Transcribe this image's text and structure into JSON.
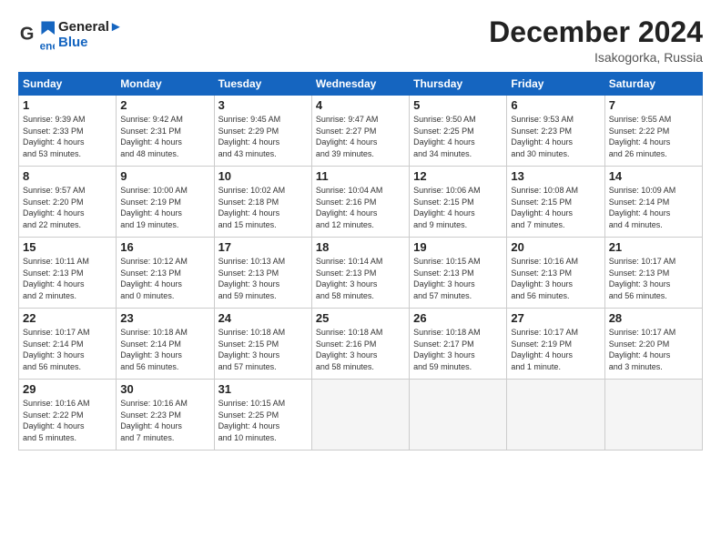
{
  "header": {
    "logo_general": "General",
    "logo_blue": "Blue",
    "month": "December 2024",
    "location": "Isakogorka, Russia"
  },
  "weekdays": [
    "Sunday",
    "Monday",
    "Tuesday",
    "Wednesday",
    "Thursday",
    "Friday",
    "Saturday"
  ],
  "weeks": [
    [
      {
        "day": "1",
        "info": "Sunrise: 9:39 AM\nSunset: 2:33 PM\nDaylight: 4 hours\nand 53 minutes."
      },
      {
        "day": "2",
        "info": "Sunrise: 9:42 AM\nSunset: 2:31 PM\nDaylight: 4 hours\nand 48 minutes."
      },
      {
        "day": "3",
        "info": "Sunrise: 9:45 AM\nSunset: 2:29 PM\nDaylight: 4 hours\nand 43 minutes."
      },
      {
        "day": "4",
        "info": "Sunrise: 9:47 AM\nSunset: 2:27 PM\nDaylight: 4 hours\nand 39 minutes."
      },
      {
        "day": "5",
        "info": "Sunrise: 9:50 AM\nSunset: 2:25 PM\nDaylight: 4 hours\nand 34 minutes."
      },
      {
        "day": "6",
        "info": "Sunrise: 9:53 AM\nSunset: 2:23 PM\nDaylight: 4 hours\nand 30 minutes."
      },
      {
        "day": "7",
        "info": "Sunrise: 9:55 AM\nSunset: 2:22 PM\nDaylight: 4 hours\nand 26 minutes."
      }
    ],
    [
      {
        "day": "8",
        "info": "Sunrise: 9:57 AM\nSunset: 2:20 PM\nDaylight: 4 hours\nand 22 minutes."
      },
      {
        "day": "9",
        "info": "Sunrise: 10:00 AM\nSunset: 2:19 PM\nDaylight: 4 hours\nand 19 minutes."
      },
      {
        "day": "10",
        "info": "Sunrise: 10:02 AM\nSunset: 2:18 PM\nDaylight: 4 hours\nand 15 minutes."
      },
      {
        "day": "11",
        "info": "Sunrise: 10:04 AM\nSunset: 2:16 PM\nDaylight: 4 hours\nand 12 minutes."
      },
      {
        "day": "12",
        "info": "Sunrise: 10:06 AM\nSunset: 2:15 PM\nDaylight: 4 hours\nand 9 minutes."
      },
      {
        "day": "13",
        "info": "Sunrise: 10:08 AM\nSunset: 2:15 PM\nDaylight: 4 hours\nand 7 minutes."
      },
      {
        "day": "14",
        "info": "Sunrise: 10:09 AM\nSunset: 2:14 PM\nDaylight: 4 hours\nand 4 minutes."
      }
    ],
    [
      {
        "day": "15",
        "info": "Sunrise: 10:11 AM\nSunset: 2:13 PM\nDaylight: 4 hours\nand 2 minutes."
      },
      {
        "day": "16",
        "info": "Sunrise: 10:12 AM\nSunset: 2:13 PM\nDaylight: 4 hours\nand 0 minutes."
      },
      {
        "day": "17",
        "info": "Sunrise: 10:13 AM\nSunset: 2:13 PM\nDaylight: 3 hours\nand 59 minutes."
      },
      {
        "day": "18",
        "info": "Sunrise: 10:14 AM\nSunset: 2:13 PM\nDaylight: 3 hours\nand 58 minutes."
      },
      {
        "day": "19",
        "info": "Sunrise: 10:15 AM\nSunset: 2:13 PM\nDaylight: 3 hours\nand 57 minutes."
      },
      {
        "day": "20",
        "info": "Sunrise: 10:16 AM\nSunset: 2:13 PM\nDaylight: 3 hours\nand 56 minutes."
      },
      {
        "day": "21",
        "info": "Sunrise: 10:17 AM\nSunset: 2:13 PM\nDaylight: 3 hours\nand 56 minutes."
      }
    ],
    [
      {
        "day": "22",
        "info": "Sunrise: 10:17 AM\nSunset: 2:14 PM\nDaylight: 3 hours\nand 56 minutes."
      },
      {
        "day": "23",
        "info": "Sunrise: 10:18 AM\nSunset: 2:14 PM\nDaylight: 3 hours\nand 56 minutes."
      },
      {
        "day": "24",
        "info": "Sunrise: 10:18 AM\nSunset: 2:15 PM\nDaylight: 3 hours\nand 57 minutes."
      },
      {
        "day": "25",
        "info": "Sunrise: 10:18 AM\nSunset: 2:16 PM\nDaylight: 3 hours\nand 58 minutes."
      },
      {
        "day": "26",
        "info": "Sunrise: 10:18 AM\nSunset: 2:17 PM\nDaylight: 3 hours\nand 59 minutes."
      },
      {
        "day": "27",
        "info": "Sunrise: 10:17 AM\nSunset: 2:19 PM\nDaylight: 4 hours\nand 1 minute."
      },
      {
        "day": "28",
        "info": "Sunrise: 10:17 AM\nSunset: 2:20 PM\nDaylight: 4 hours\nand 3 minutes."
      }
    ],
    [
      {
        "day": "29",
        "info": "Sunrise: 10:16 AM\nSunset: 2:22 PM\nDaylight: 4 hours\nand 5 minutes."
      },
      {
        "day": "30",
        "info": "Sunrise: 10:16 AM\nSunset: 2:23 PM\nDaylight: 4 hours\nand 7 minutes."
      },
      {
        "day": "31",
        "info": "Sunrise: 10:15 AM\nSunset: 2:25 PM\nDaylight: 4 hours\nand 10 minutes."
      },
      {
        "day": "",
        "info": ""
      },
      {
        "day": "",
        "info": ""
      },
      {
        "day": "",
        "info": ""
      },
      {
        "day": "",
        "info": ""
      }
    ]
  ]
}
